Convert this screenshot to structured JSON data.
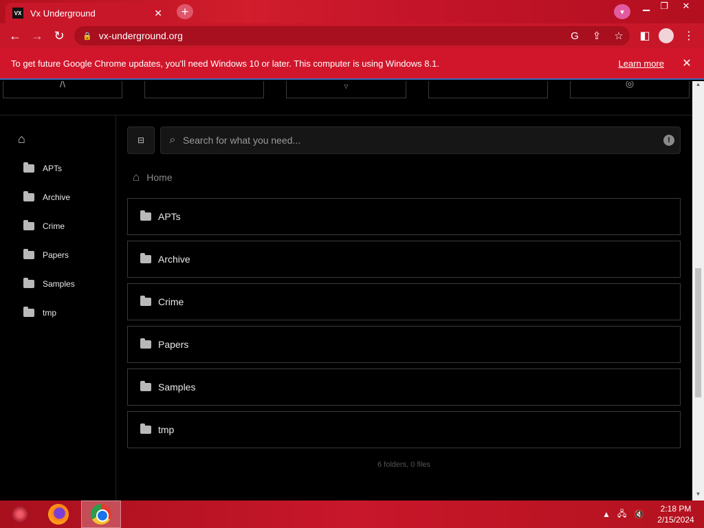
{
  "browser": {
    "tab_title": "Vx Underground",
    "favicon_text": "VX",
    "url": "vx-underground.org",
    "infobar_text": "To get future Google Chrome updates, you'll need Windows 10 or later. This computer is using Windows 8.1.",
    "infobar_link": "Learn more"
  },
  "sidebar": {
    "items": [
      {
        "label": "APTs"
      },
      {
        "label": "Archive"
      },
      {
        "label": "Crime"
      },
      {
        "label": "Papers"
      },
      {
        "label": "Samples"
      },
      {
        "label": "tmp"
      }
    ]
  },
  "main": {
    "search_placeholder": "Search for what you need...",
    "breadcrumb_home": "Home",
    "folders": [
      {
        "label": "APTs"
      },
      {
        "label": "Archive"
      },
      {
        "label": "Crime"
      },
      {
        "label": "Papers"
      },
      {
        "label": "Samples"
      },
      {
        "label": "tmp"
      }
    ],
    "summary": "6 folders, 0 files"
  },
  "taskbar": {
    "time": "2:18 PM",
    "date": "2/15/2024"
  },
  "colors": {
    "accent": "#c9172a",
    "page_bg": "#000000",
    "border": "#3a3a3a"
  }
}
